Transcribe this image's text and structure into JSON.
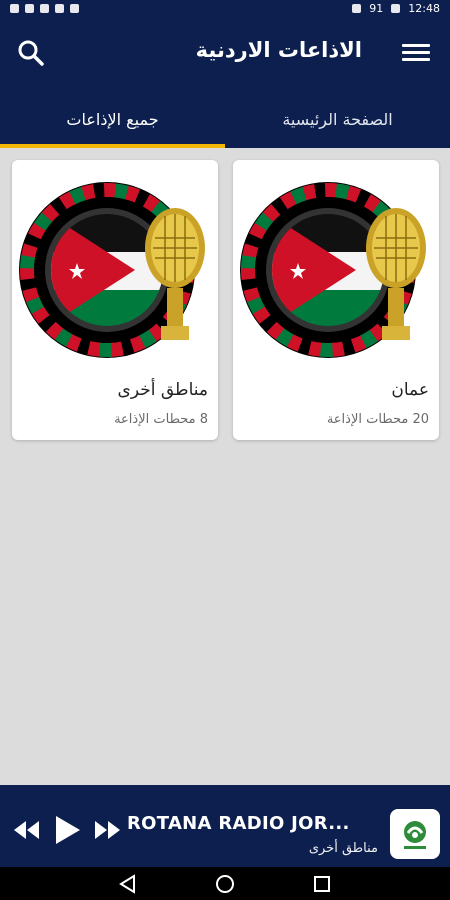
{
  "statusbar": {
    "battery": "91",
    "time": "12:48"
  },
  "appbar": {
    "title": "الاذاعات الاردنية",
    "menu_icon": "menu-icon",
    "search_icon": "search-icon"
  },
  "tabs": [
    {
      "label": "الصفحة الرئيسية",
      "active": false
    },
    {
      "label": "جميع الإذاعات",
      "active": true
    }
  ],
  "cards": [
    {
      "name": "عمان",
      "count": "20 محطات الإذاعة"
    },
    {
      "name": "مناطق أخرى",
      "count": "8 محطات الإذاعة"
    }
  ],
  "player": {
    "track": "ROTANA RADIO JOR...",
    "subtitle": "مناطق أخرى",
    "controls": [
      "rewind-icon",
      "play-icon",
      "fast-forward-icon"
    ]
  },
  "colors": {
    "primary": "#0d1f4f",
    "accent": "#f2b705",
    "background": "#dcdcdc",
    "flag_red": "#ce1126",
    "flag_green": "#007a3d",
    "flag_black": "#000000"
  }
}
